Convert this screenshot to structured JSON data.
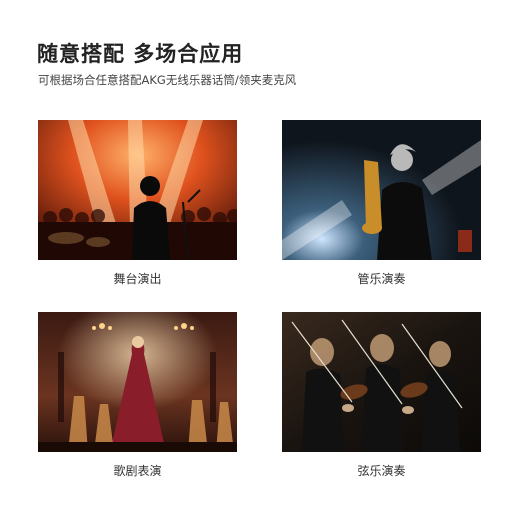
{
  "title": "随意搭配 多场合应用",
  "subtitle": "可根据场合任意搭配AKG无线乐器话筒/领夹麦克风",
  "scenes": [
    {
      "caption": "舞台演出"
    },
    {
      "caption": "管乐演奏"
    },
    {
      "caption": "歌剧表演"
    },
    {
      "caption": "弦乐演奏"
    }
  ],
  "colors": {
    "stage_warm": "#e0521e",
    "sax_dark": "#0f151c",
    "opera_red": "#8a1d2a",
    "strings_dark": "#1a1410"
  }
}
